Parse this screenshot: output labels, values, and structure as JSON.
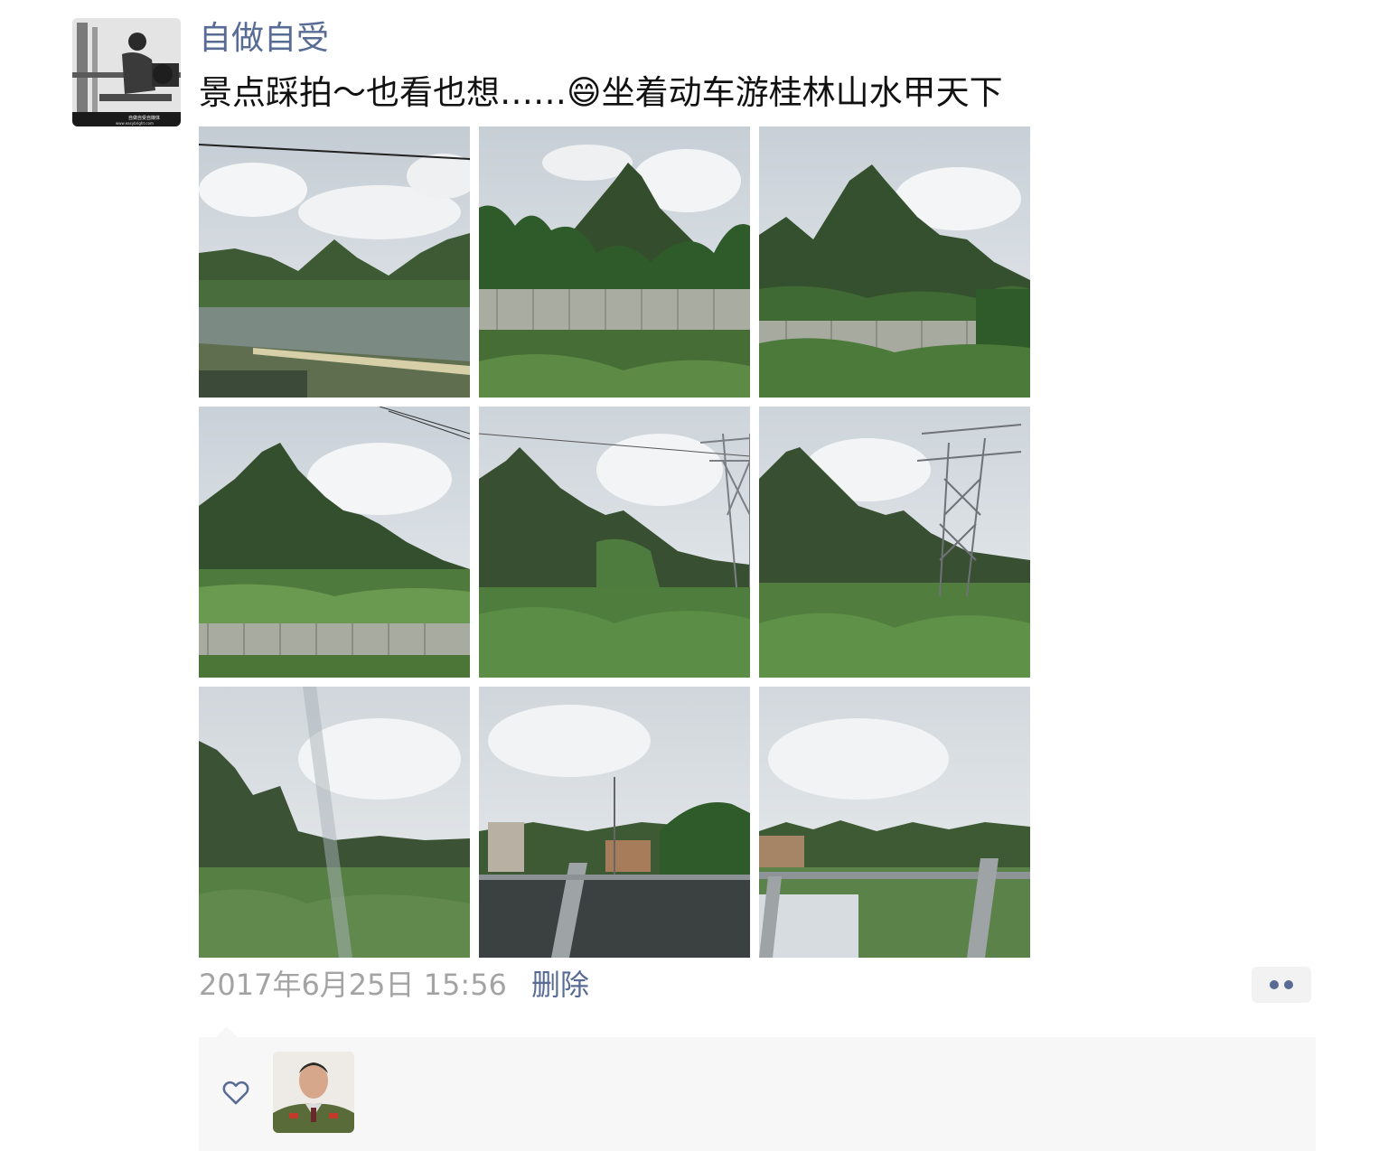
{
  "post": {
    "author": "自做自受",
    "text": "景点踩拍～也看也想……😄坐着动车游桂林山水甲天下",
    "avatar_caption": "自做自受自媒体",
    "avatar_caption_url": "www.easybright.com",
    "photo_count": 9,
    "timestamp": "2017年6月25日 15:56",
    "delete_label": "删除"
  },
  "likes": {
    "icon": "heart-outline-icon",
    "likers": [
      "liker-avatar"
    ]
  },
  "colors": {
    "link_blue": "#576b95",
    "timestamp_gray": "#a3a3a3",
    "panel_bg": "#f7f7f7"
  }
}
